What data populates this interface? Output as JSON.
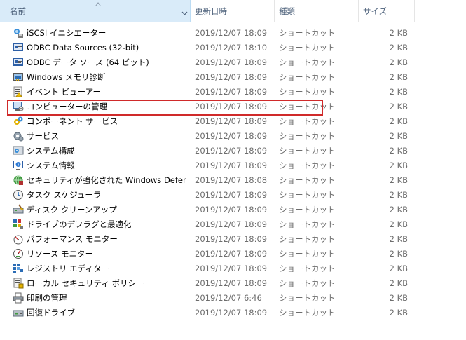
{
  "columns": {
    "name": "名前",
    "date": "更新日時",
    "type": "種類",
    "size": "サイズ"
  },
  "sort": {
    "column": "name",
    "direction": "ascending"
  },
  "highlight_color": "#d02a2a",
  "files": [
    {
      "name": "iSCSI イニシエーター",
      "date": "2019/12/07 18:09",
      "type": "ショートカット",
      "size": "2 KB",
      "icon": "iscsi-initiator-icon"
    },
    {
      "name": "ODBC Data Sources (32-bit)",
      "date": "2019/12/07 18:10",
      "type": "ショートカット",
      "size": "2 KB",
      "icon": "odbc-icon"
    },
    {
      "name": "ODBC データ ソース (64 ビット)",
      "date": "2019/12/07 18:09",
      "type": "ショートカット",
      "size": "2 KB",
      "icon": "odbc-icon"
    },
    {
      "name": "Windows メモリ診断",
      "date": "2019/12/07 18:09",
      "type": "ショートカット",
      "size": "2 KB",
      "icon": "memory-diagnostic-icon"
    },
    {
      "name": "イベント ビューアー",
      "date": "2019/12/07 18:09",
      "type": "ショートカット",
      "size": "2 KB",
      "icon": "event-viewer-icon"
    },
    {
      "name": "コンピューターの管理",
      "date": "2019/12/07 18:09",
      "type": "ショートカット",
      "size": "2 KB",
      "icon": "computer-management-icon",
      "highlighted": true
    },
    {
      "name": "コンポーネント サービス",
      "date": "2019/12/07 18:09",
      "type": "ショートカット",
      "size": "2 KB",
      "icon": "component-services-icon"
    },
    {
      "name": "サービス",
      "date": "2019/12/07 18:09",
      "type": "ショートカット",
      "size": "2 KB",
      "icon": "services-icon"
    },
    {
      "name": "システム構成",
      "date": "2019/12/07 18:09",
      "type": "ショートカット",
      "size": "2 KB",
      "icon": "system-configuration-icon"
    },
    {
      "name": "システム情報",
      "date": "2019/12/07 18:09",
      "type": "ショートカット",
      "size": "2 KB",
      "icon": "system-information-icon"
    },
    {
      "name": "セキュリティが強化された Windows Defender...",
      "date": "2019/12/07 18:08",
      "type": "ショートカット",
      "size": "2 KB",
      "icon": "defender-firewall-icon"
    },
    {
      "name": "タスク スケジューラ",
      "date": "2019/12/07 18:09",
      "type": "ショートカット",
      "size": "2 KB",
      "icon": "task-scheduler-icon"
    },
    {
      "name": "ディスク クリーンアップ",
      "date": "2019/12/07 18:09",
      "type": "ショートカット",
      "size": "2 KB",
      "icon": "disk-cleanup-icon"
    },
    {
      "name": "ドライブのデフラグと最適化",
      "date": "2019/12/07 18:09",
      "type": "ショートカット",
      "size": "2 KB",
      "icon": "defrag-icon"
    },
    {
      "name": "パフォーマンス モニター",
      "date": "2019/12/07 18:09",
      "type": "ショートカット",
      "size": "2 KB",
      "icon": "performance-monitor-icon"
    },
    {
      "name": "リソース モニター",
      "date": "2019/12/07 18:09",
      "type": "ショートカット",
      "size": "2 KB",
      "icon": "resource-monitor-icon"
    },
    {
      "name": "レジストリ エディター",
      "date": "2019/12/07 18:09",
      "type": "ショートカット",
      "size": "2 KB",
      "icon": "registry-editor-icon"
    },
    {
      "name": "ローカル セキュリティ ポリシー",
      "date": "2019/12/07 18:09",
      "type": "ショートカット",
      "size": "2 KB",
      "icon": "local-security-policy-icon"
    },
    {
      "name": "印刷の管理",
      "date": "2019/12/07 6:46",
      "type": "ショートカット",
      "size": "2 KB",
      "icon": "print-management-icon"
    },
    {
      "name": "回復ドライブ",
      "date": "2019/12/07 18:09",
      "type": "ショートカット",
      "size": "2 KB",
      "icon": "recovery-drive-icon"
    }
  ]
}
